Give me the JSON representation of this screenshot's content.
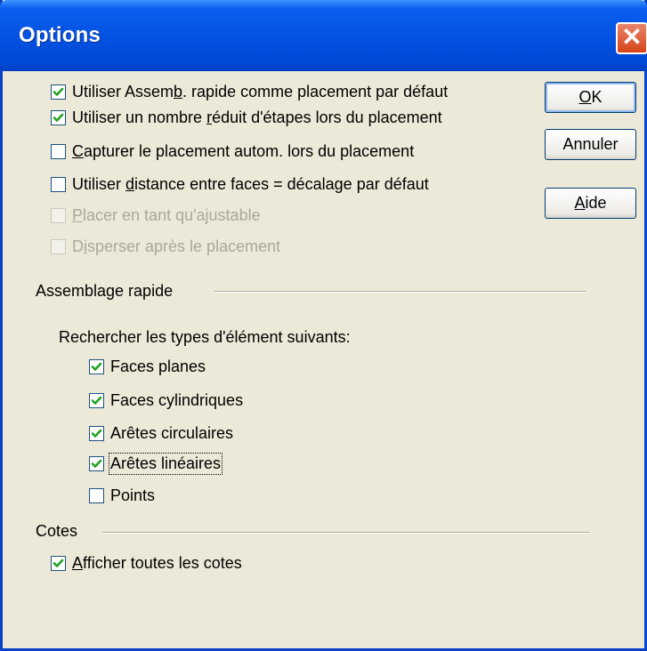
{
  "window": {
    "title": "Options",
    "close_glyph": "✕"
  },
  "checkboxes": [
    {
      "pre": "Utiliser Assem",
      "u": "b",
      "post": ". rapide comme placement par défaut",
      "checked": true,
      "disabled": false
    },
    {
      "pre": "Utiliser un nombre ",
      "u": "r",
      "post": "éduit d'étapes lors du placement",
      "checked": true,
      "disabled": false
    },
    {
      "pre": "",
      "u": "C",
      "post": "apturer le placement autom. lors du placement",
      "checked": false,
      "disabled": false
    },
    {
      "pre": "Utiliser ",
      "u": "d",
      "post": "istance entre faces = décalage par défaut",
      "checked": false,
      "disabled": false
    },
    {
      "pre": "",
      "u": "P",
      "post": "lacer en tant qu'ajustable",
      "checked": false,
      "disabled": true
    },
    {
      "pre": "D",
      "u": "i",
      "post": "sperser après le placement",
      "checked": false,
      "disabled": true
    }
  ],
  "buttons": {
    "ok": {
      "pre": "",
      "u": "O",
      "post": "K"
    },
    "cancel": {
      "pre": "Annuler",
      "u": "",
      "post": ""
    },
    "help": {
      "pre": "",
      "u": "A",
      "post": "ide"
    }
  },
  "assemblage": {
    "title": "Assemblage rapide",
    "search_label": "Rechercher les types d'élément suivants:",
    "items": [
      {
        "label": "Faces planes",
        "checked": true
      },
      {
        "label": "Faces cylindriques",
        "checked": true
      },
      {
        "label": "Arêtes circulaires",
        "checked": true
      },
      {
        "label": "Arêtes linéaires",
        "checked": true
      },
      {
        "label": "Points",
        "checked": false
      }
    ]
  },
  "cotes": {
    "title": "Cotes",
    "show_all": {
      "pre": "",
      "u": "A",
      "post": "fficher toutes les cotes",
      "checked": true
    }
  },
  "colors": {
    "titlebar": "#0553e2",
    "check": "#21a121",
    "face": "#ece9d8"
  }
}
